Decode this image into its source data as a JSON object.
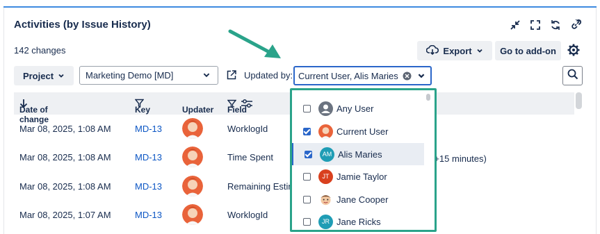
{
  "header": {
    "title": "Activities (by Issue History)",
    "changes": "142 changes"
  },
  "toolbar": {
    "export_label": "Export",
    "addon_label": "Go to add-on"
  },
  "filters": {
    "project_label": "Project",
    "project_value": "Marketing Demo [MD]",
    "updated_by_label": "Updated by:",
    "updated_by_value": "Current User, Alis Maries"
  },
  "table": {
    "columns": [
      "Date of change",
      "Key",
      "Updater",
      "Field"
    ],
    "rows": [
      {
        "date": "Mar 08, 2025, 1:08 AM",
        "key": "MD-13",
        "field": "WorklogId"
      },
      {
        "date": "Mar 08, 2025, 1:08 AM",
        "key": "MD-13",
        "field": "Time Spent"
      },
      {
        "date": "Mar 08, 2025, 1:08 AM",
        "key": "MD-13",
        "field": "Remaining Estim"
      },
      {
        "date": "Mar 08, 2025, 1:07 AM",
        "key": "MD-13",
        "field": "WorklogId"
      }
    ],
    "extra_text": "(+15 minutes)"
  },
  "dropdown": {
    "options": [
      {
        "label": "Any User",
        "checked": false,
        "avatar": "generic"
      },
      {
        "label": "Current User",
        "checked": true,
        "avatar": "photo"
      },
      {
        "label": "Alis Maries",
        "checked": true,
        "avatar": "AM",
        "color": "#1f9db5"
      },
      {
        "label": "Jamie Taylor",
        "checked": false,
        "avatar": "JT",
        "color": "#d9401e"
      },
      {
        "label": "Jane Cooper",
        "checked": false,
        "avatar": "cartoon"
      },
      {
        "label": "Jane Ricks",
        "checked": false,
        "avatar": "JR",
        "color": "#1f9db5"
      }
    ]
  },
  "colors": {
    "accent": "#2a66c9",
    "highlight_border": "#2aa38a",
    "link": "#0c56c4"
  }
}
